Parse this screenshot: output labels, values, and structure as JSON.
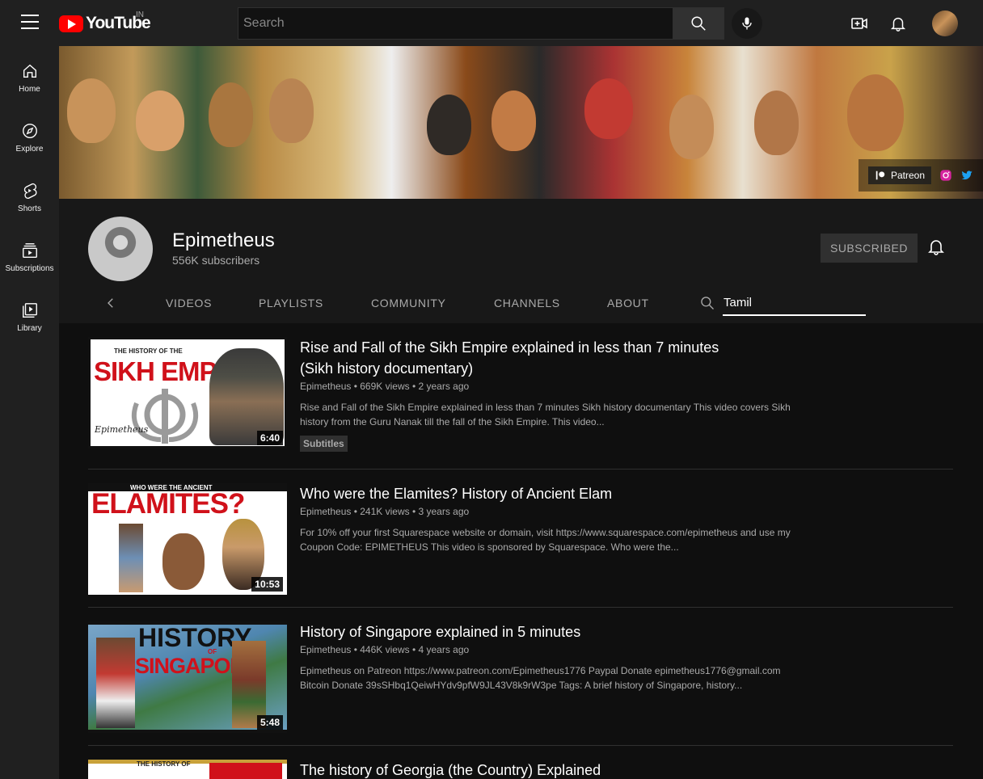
{
  "topbar": {
    "logo_text": "YouTube",
    "country_code": "IN",
    "search_placeholder": "Search"
  },
  "sidebar": {
    "items": [
      {
        "label": "Home",
        "icon": "home-icon"
      },
      {
        "label": "Explore",
        "icon": "compass-icon"
      },
      {
        "label": "Shorts",
        "icon": "shorts-icon"
      },
      {
        "label": "Subscriptions",
        "icon": "subscriptions-icon"
      },
      {
        "label": "Library",
        "icon": "library-icon"
      }
    ]
  },
  "banner": {
    "patreon_label": "Patreon"
  },
  "channel": {
    "name": "Epimetheus",
    "subscribers": "556K subscribers",
    "subscribe_label": "SUBSCRIBED",
    "tabs": [
      "VIDEOS",
      "PLAYLISTS",
      "COMMUNITY",
      "CHANNELS",
      "ABOUT"
    ],
    "search_value": "Tamil"
  },
  "results": [
    {
      "title": "Rise and Fall of the Sikh Empire explained in less than 7 minutes (Sikh history documentary)",
      "meta": "Epimetheus • 669K views • 2 years ago",
      "description": "Rise and Fall of the Sikh Empire explained in less than 7 minutes Sikh history documentary This video covers Sikh history from the Guru Nanak till the fall of the Sikh Empire. This video...",
      "duration": "6:40",
      "badge": "Subtitles",
      "thumb_top": "THE HISTORY OF THE",
      "thumb_big": "SIKH EMPIRE",
      "thumb_sig": "Epimetheus"
    },
    {
      "title": "Who were the Elamites? History of Ancient Elam",
      "meta": "Epimetheus • 241K views • 3 years ago",
      "description": "For 10% off your first Squarespace website or domain, visit https://www.squarespace.com/epimetheus and use my Coupon Code: EPIMETHEUS This video is sponsored by Squarespace. Who were the...",
      "duration": "10:53",
      "thumb_top": "WHO WERE THE ANCIENT",
      "thumb_big": "ELAMITES?"
    },
    {
      "title": "History of Singapore explained in 5 minutes",
      "meta": "Epimetheus • 446K views • 4 years ago",
      "description": "Epimetheus on Patreon https://www.patreon.com/Epimetheus1776 Paypal Donate epimetheus1776@gmail.com Bitcoin Donate 39sSHbq1QeiwHYdv9pfW9JL43V8k9rW3pe Tags: A brief history of Singapore, history...",
      "duration": "5:48",
      "thumb_big": "HISTORY",
      "thumb_of": "OF",
      "thumb_big2": "SINGAPORE"
    },
    {
      "title": "The history of Georgia (the Country) Explained",
      "thumb_top": "THE HISTORY OF"
    }
  ],
  "colors": {
    "accent_red": "#ff0000",
    "background": "#0f0f0f",
    "surface": "#202020"
  }
}
